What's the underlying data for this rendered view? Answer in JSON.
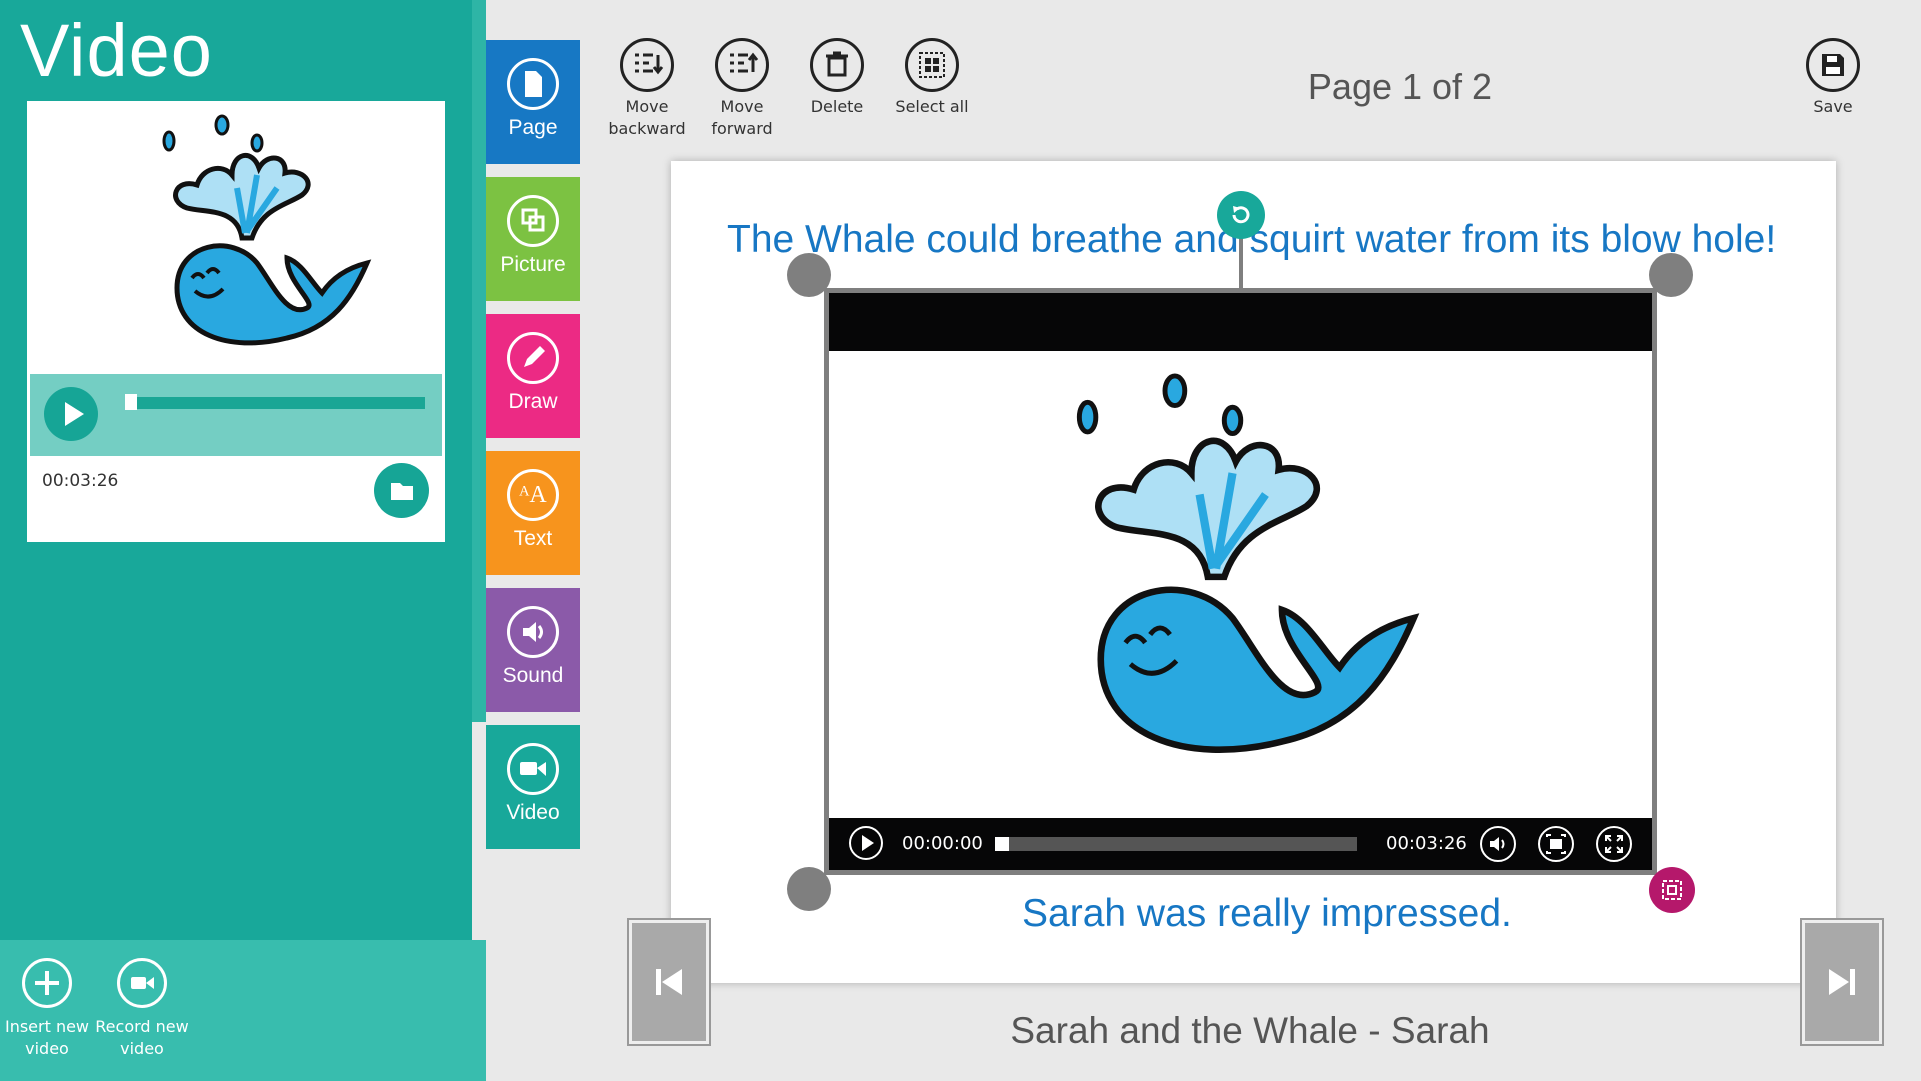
{
  "panel": {
    "title": "Video",
    "preview_time": "00:03:26",
    "actions": [
      {
        "label_line1": "Insert new",
        "label_line2": "video",
        "icon": "plus-icon"
      },
      {
        "label_line1": "Record new",
        "label_line2": "video",
        "icon": "video-camera-icon"
      }
    ],
    "progress_fraction": 0.0
  },
  "categories": [
    {
      "label": "Page",
      "color": "#1778c4",
      "icon": "page-icon"
    },
    {
      "label": "Picture",
      "color": "#7cc242",
      "icon": "picture-icon"
    },
    {
      "label": "Draw",
      "color": "#ec2a84",
      "icon": "pencil-icon"
    },
    {
      "label": "Text",
      "color": "#f7941d",
      "icon": "text-icon"
    },
    {
      "label": "Sound",
      "color": "#8b5aa9",
      "icon": "speaker-icon"
    },
    {
      "label": "Video",
      "color": "#18a89a",
      "icon": "video-camera-icon",
      "selected": true
    }
  ],
  "toolbar": {
    "move_backward": {
      "line1": "Move",
      "line2": "backward"
    },
    "move_forward": {
      "line1": "Move",
      "line2": "forward"
    },
    "delete": "Delete",
    "select_all": "Select all",
    "save": "Save",
    "page_indicator": "Page 1 of 2"
  },
  "page": {
    "caption_top": "The Whale could breathe and squirt water from its blow hole!",
    "caption_bottom": "Sarah was really impressed.",
    "video": {
      "current_time": "00:00:00",
      "duration": "00:03:26",
      "progress_fraction": 0.0
    }
  },
  "footer": {
    "document_title": "Sarah and the Whale - Sarah"
  },
  "colors": {
    "panel_bg": "#18a89a",
    "caption": "#1777c4",
    "accent_pink": "#b5186b"
  }
}
